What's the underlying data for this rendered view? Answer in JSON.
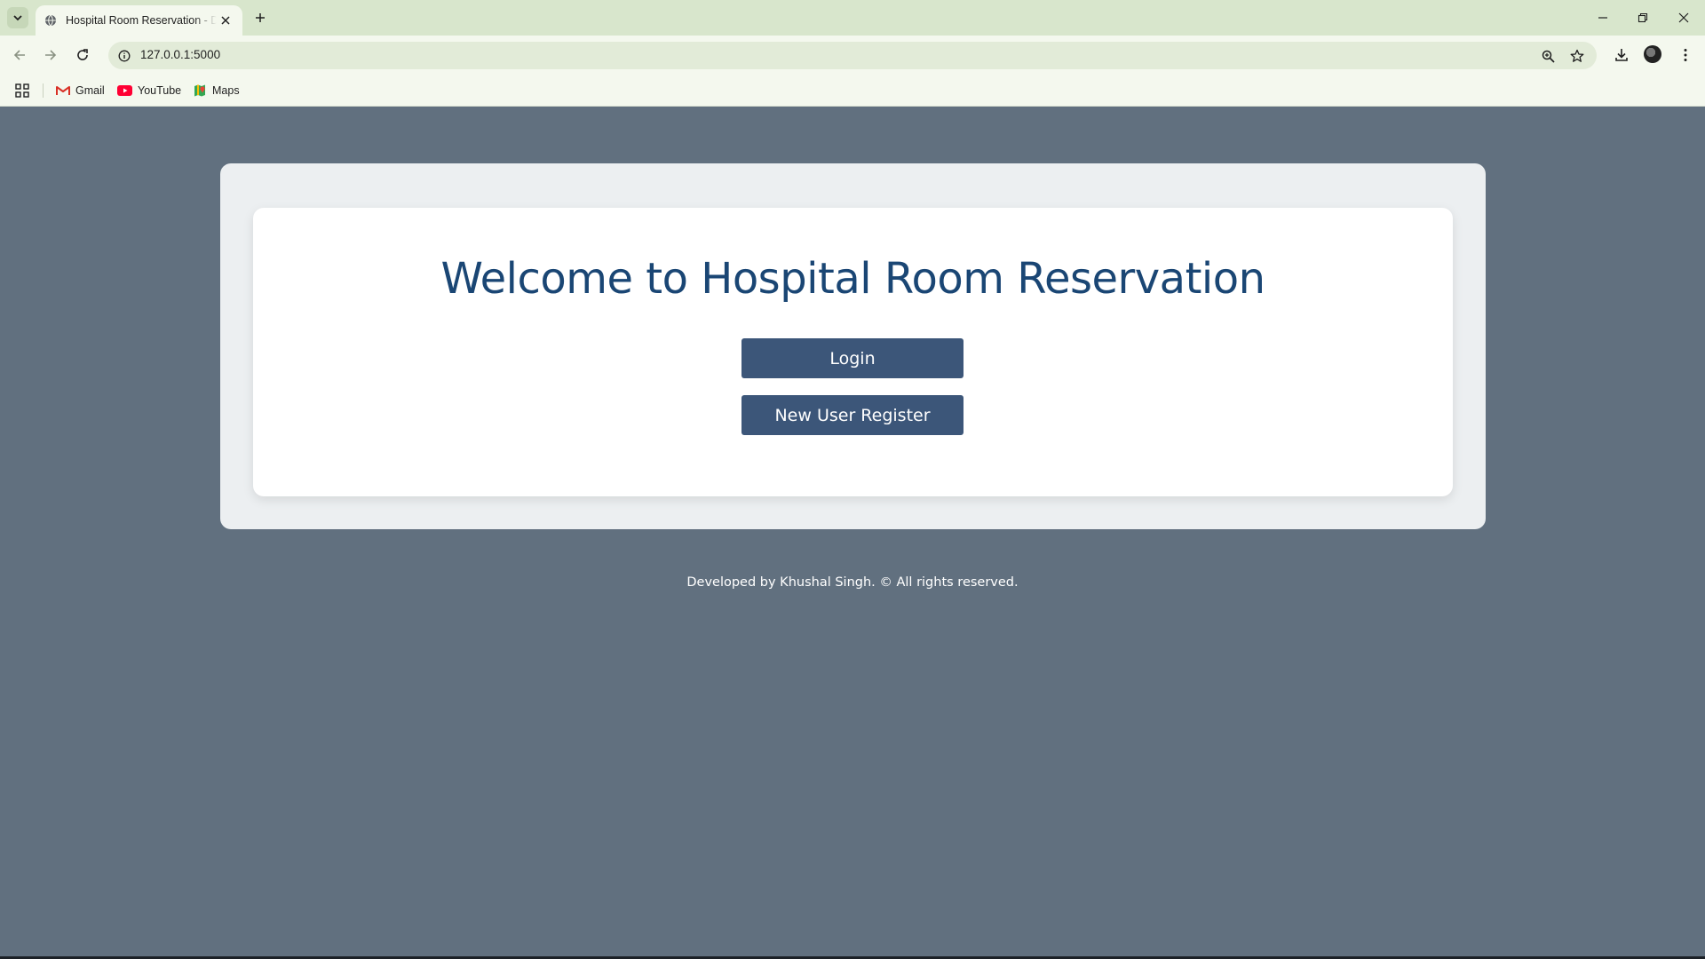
{
  "browser": {
    "tab_title": "Hospital Room Reservation - Dashboard",
    "url": "127.0.0.1:5000",
    "bookmarks": [
      {
        "label": "Gmail",
        "icon": "gmail-icon"
      },
      {
        "label": "YouTube",
        "icon": "youtube-icon"
      },
      {
        "label": "Maps",
        "icon": "maps-icon"
      }
    ]
  },
  "page": {
    "heading": "Welcome to Hospital Room Reservation",
    "login_label": "Login",
    "register_label": "New User Register",
    "footer": "Developed by Khushal Singh. © All rights reserved."
  },
  "colors": {
    "page_bg": "#61707f",
    "heading": "#1a4674",
    "button_bg": "#3c5679",
    "chrome_bg": "#d8e6cc"
  }
}
